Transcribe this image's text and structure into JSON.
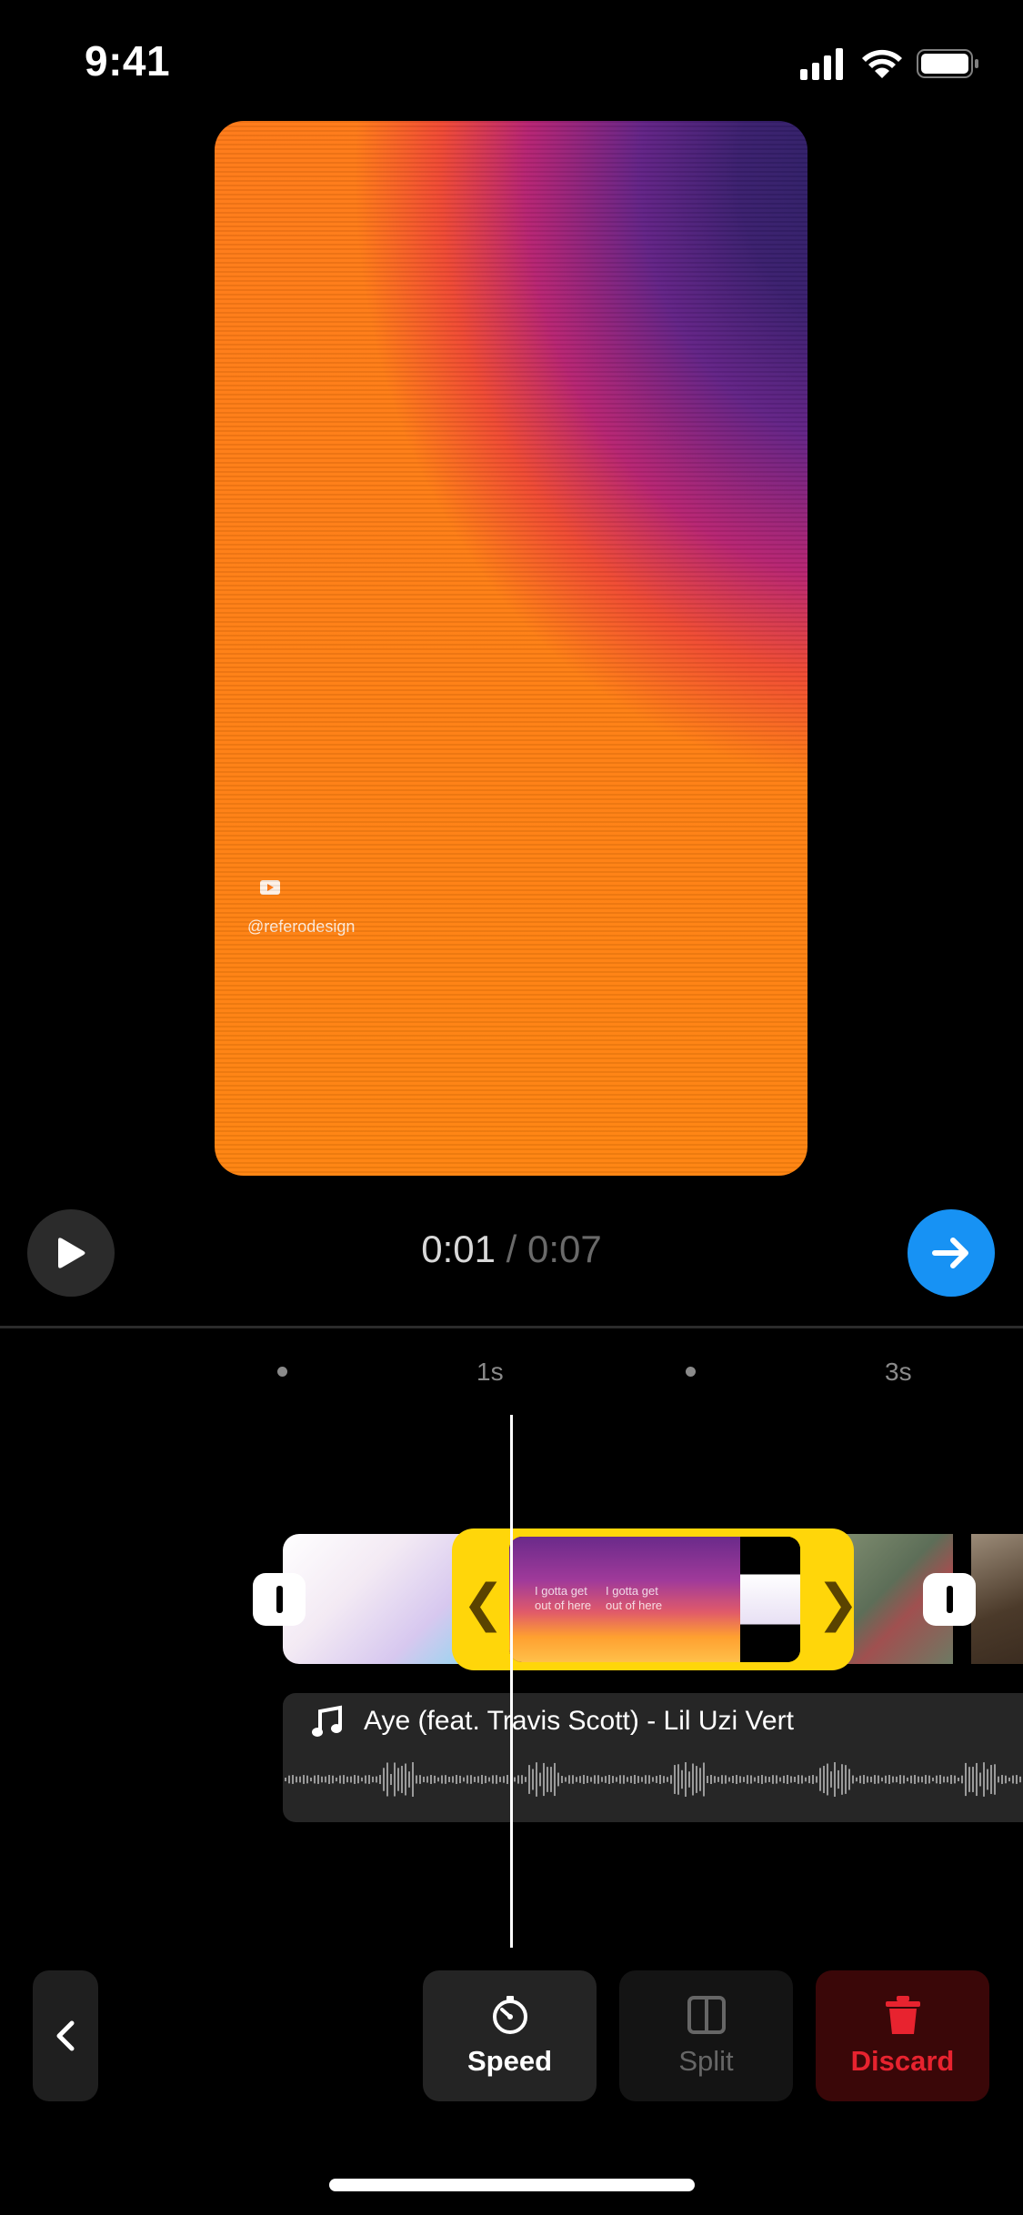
{
  "status_bar": {
    "time": "9:41"
  },
  "preview": {
    "watermark": "@referodesign"
  },
  "playback": {
    "current": "0:01",
    "separator": " / ",
    "total": "0:07"
  },
  "ruler": {
    "label_1": "1s",
    "label_3": "3s"
  },
  "selected_clip": {
    "frame_text": "I gotta get out of here"
  },
  "audio": {
    "title": "Aye (feat. Travis Scott) - Lil Uzi Vert"
  },
  "toolbar": {
    "speed": "Speed",
    "split": "Split",
    "discard": "Discard"
  },
  "colors": {
    "accent": "#1792f4",
    "selection": "#ffd60a",
    "danger": "#e8232f"
  },
  "icons": [
    "chevron-left-icon",
    "play-icon",
    "arrow-right-icon",
    "music-note-icon",
    "speedometer-icon",
    "split-icon",
    "trash-icon"
  ]
}
